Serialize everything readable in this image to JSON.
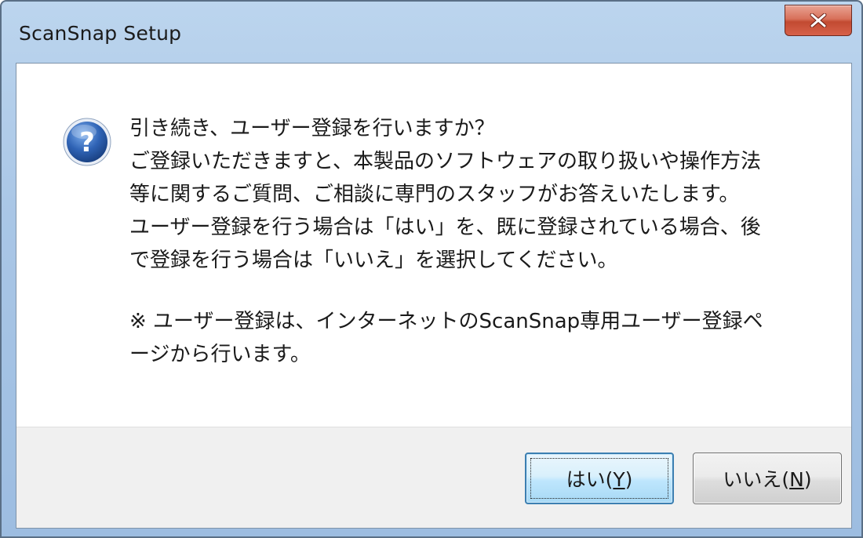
{
  "window": {
    "title": "ScanSnap Setup"
  },
  "icons": {
    "close": "close-icon",
    "question": "question-icon"
  },
  "colors": {
    "titlebar": "#a9c6e6",
    "close_button": "#c24a31",
    "question_icon": "#2f63b5",
    "footer": "#f0f0f0",
    "default_button_border": "#3c7fb1"
  },
  "message": {
    "lines": [
      "引き続き、ユーザー登録を行いますか？",
      "ご登録いただきますと、本製品のソフトウェアの取り扱いや操作方法",
      "等に関するご質問、ご相談に専門のスタッフがお答えいたします。",
      "ユーザー登録を行う場合は「はい」を、既に登録されている場合、後",
      "で登録を行う場合は「いいえ」を選択してください。"
    ],
    "note_lines": [
      "※ ユーザー登録は、インターネットのScanSnap専用ユーザー登録ペ",
      "ージから行います。"
    ]
  },
  "buttons": {
    "yes": {
      "label": "はい(",
      "mnemonic": "Y",
      "suffix": ")"
    },
    "no": {
      "label": "いいえ(",
      "mnemonic": "N",
      "suffix": ")"
    }
  }
}
